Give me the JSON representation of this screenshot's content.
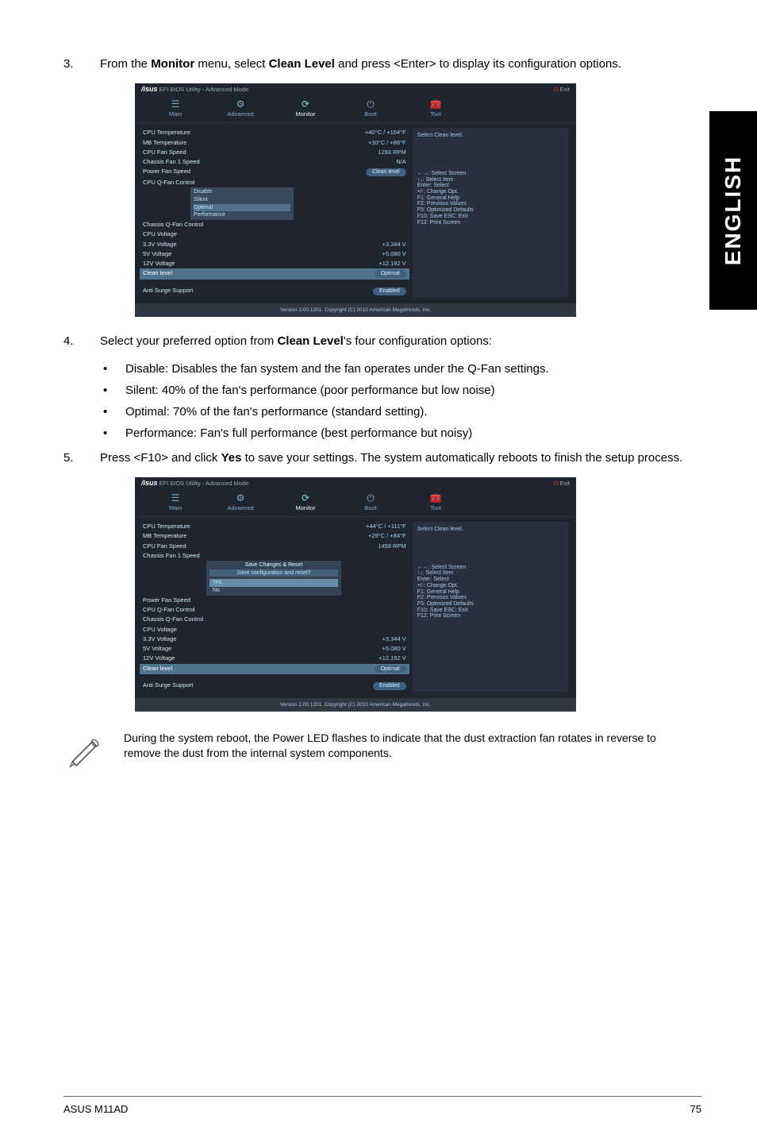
{
  "lang_tab": "ENGLISH",
  "step3": {
    "num": "3.",
    "text_pre": "From the ",
    "menu_bold": "Monitor",
    "text_mid": " menu, select ",
    "item_bold": "Clean Level",
    "text_post": " and press <Enter> to display its configuration options."
  },
  "bios1": {
    "title": "EFI BIOS Utility - Advanced Mode",
    "exit": "Exit",
    "tabs": {
      "main": "Main",
      "advanced": "Advanced",
      "monitor": "Monitor",
      "boot": "Boot",
      "tool": "Tool"
    },
    "right_title": "Select Clean level.",
    "right_help": "←→: Select Screen\n↑↓: Select Item\nEnter: Select\n+/-: Change Opt.\nF1: General Help\nF2: Previous Values\nF5: Optimized Defaults\nF10: Save  ESC: Exit\nF12: Print Screen",
    "rows": {
      "cpu_temp_l": "CPU Temperature",
      "cpu_temp_v": "+40°C / +104°F",
      "mb_temp_l": "MB Temperature",
      "mb_temp_v": "+30°C / +86°F",
      "cpu_fan_l": "CPU Fan Speed",
      "cpu_fan_v": "1293 RPM",
      "cha_fan_l": "Chassis Fan 1 Speed",
      "cha_fan_v": "N/A",
      "pwr_fan_l": "Power Fan Speed",
      "pwr_fan_btn": "Clean level",
      "cpu_qfan_l": "CPU Q-Fan Control",
      "cha_qfan_l": "Chassis Q-Fan Control",
      "cpu_volt_l": "CPU Voltage",
      "v33_l": "3.3V Voltage",
      "v33_v": "+3.344 V",
      "v5_l": "5V Voltage",
      "v5_v": "+5.080 V",
      "v12_l": "12V Voltage",
      "v12_v": "+12.192 V",
      "clean_l": "Clean level",
      "clean_v": "Optimal",
      "anti_l": "Anti Surge Support",
      "anti_v": "Enabled"
    },
    "opts": {
      "o1": "Disable",
      "o2": "Silent",
      "o3": "Optimal",
      "o4": "Performance"
    },
    "footer": "Version 2.00.1201. Copyright (C) 2010 American Megatrends, Inc."
  },
  "step4": {
    "num": "4.",
    "text_pre": "Select your preferred option from ",
    "bold": "Clean Level",
    "text_post": "'s four configuration options:"
  },
  "bullets": {
    "b1": "Disable: Disables the fan system and the fan operates under the Q-Fan settings.",
    "b2": "Silent: 40% of the fan's performance (poor performance but low noise)",
    "b3": "Optimal: 70% of the fan's performance (standard setting).",
    "b4": "Performance: Fan's full performance (best performance but noisy)"
  },
  "step5": {
    "num": "5.",
    "text_pre": "Press <F10> and click ",
    "bold": "Yes",
    "text_post": " to save your settings. The system automatically reboots to finish the setup process."
  },
  "bios2": {
    "rows": {
      "cpu_temp_v": "+44°C / +111°F",
      "mb_temp_v": "+29°C / +84°F",
      "cpu_fan_v": "1459 RPM"
    },
    "dialog_title": "Save Changes & Reset",
    "dialog_msg": "Save configuration and reset?",
    "yes": "Yes",
    "no": "No"
  },
  "note": "During the system reboot, the Power LED flashes to indicate that the dust extraction fan rotates in reverse to remove the dust from the internal system components.",
  "footer_left": "ASUS M11AD",
  "footer_right": "75"
}
